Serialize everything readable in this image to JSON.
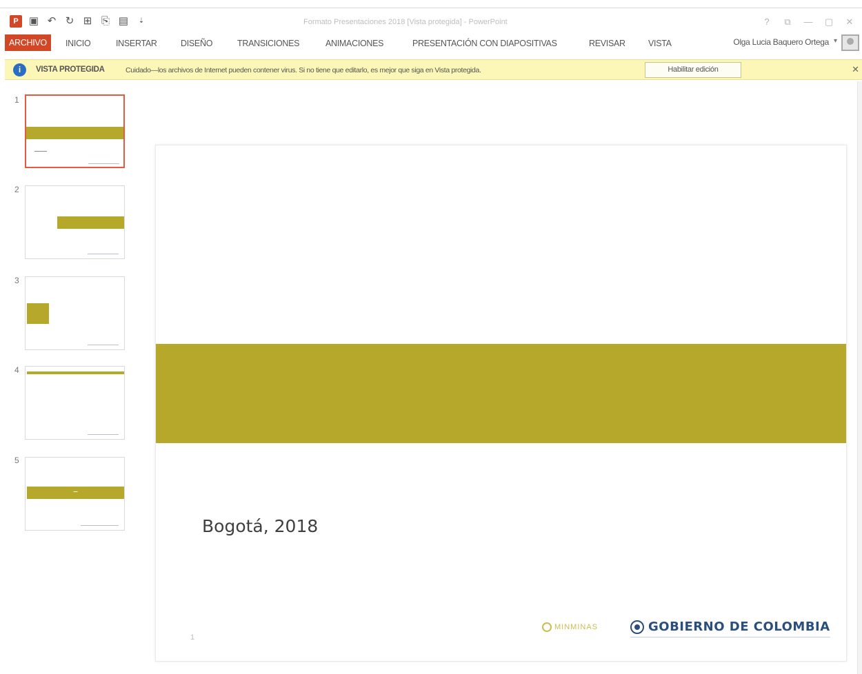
{
  "app": {
    "document_title": "Formato Presentaciones 2018 [Vista protegida] - PowerPoint",
    "window_controls": [
      "?",
      "⧉",
      "—",
      "▢",
      "✕"
    ]
  },
  "ribbon": {
    "tabs": [
      "ARCHIVO",
      "INICIO",
      "INSERTAR",
      "DISEÑO",
      "TRANSICIONES",
      "ANIMACIONES",
      "PRESENTACIÓN CON DIAPOSITIVAS",
      "REVISAR",
      "VISTA"
    ],
    "user_name": "Olga Lucia Baquero Ortega"
  },
  "protected_view": {
    "title": "VISTA PROTEGIDA",
    "message": "Cuidado—los archivos de Internet pueden contener virus. Si no tiene que editarlo, es mejor que siga en Vista protegida.",
    "enable_button": "Habilitar edición",
    "close_glyph": "✕"
  },
  "thumbnails": {
    "numbers": [
      "1",
      "2",
      "3",
      "4",
      "5"
    ],
    "selected": 1
  },
  "slide": {
    "location_date": "Bogotá, 2018",
    "slide_number": "1",
    "footer_logo_ministry": "MINMINAS",
    "footer_logo_government": "GOBIERNO DE COLOMBIA",
    "accent_color": "#b5a82b"
  }
}
